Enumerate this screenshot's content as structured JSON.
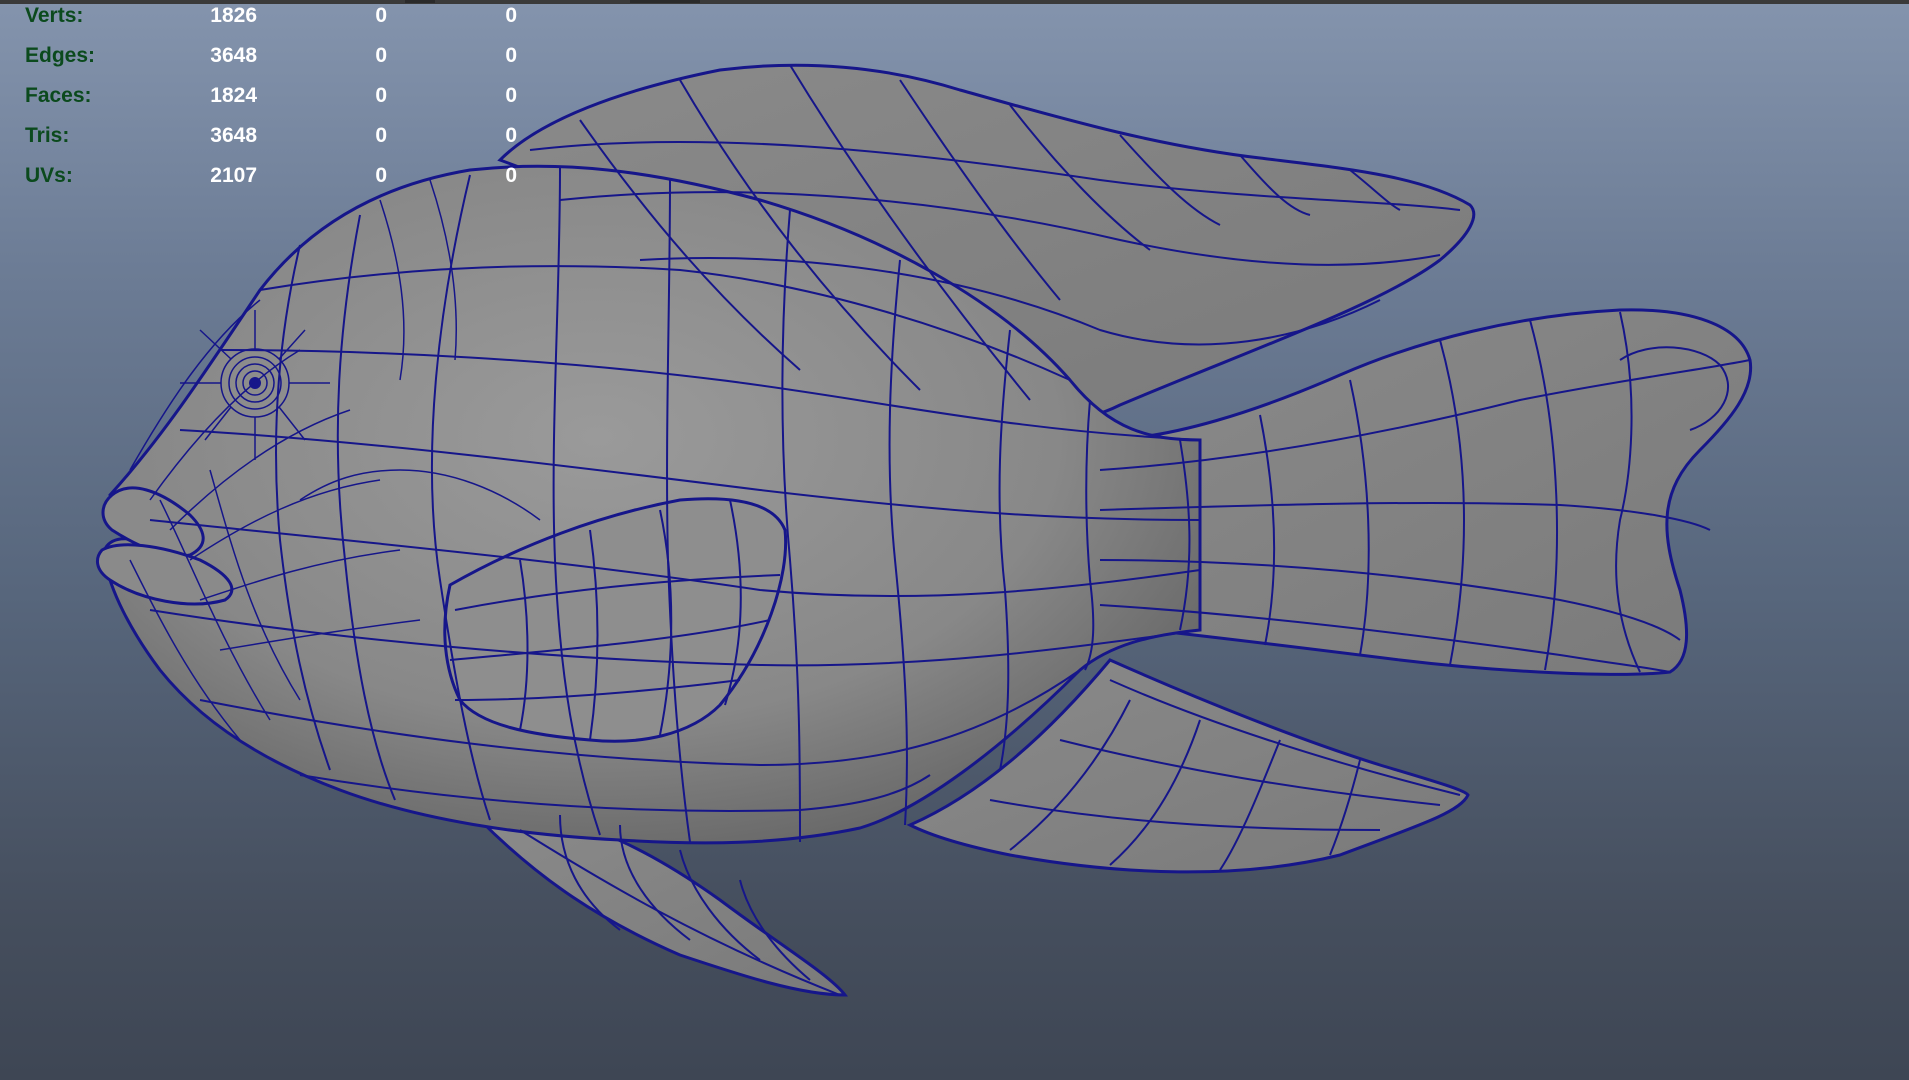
{
  "hud": {
    "rows": [
      {
        "label": "Verts:",
        "v1": "1826",
        "v2": "0",
        "v3": "0"
      },
      {
        "label": "Edges:",
        "v1": "3648",
        "v2": "0",
        "v3": "0"
      },
      {
        "label": "Faces:",
        "v1": "1824",
        "v2": "0",
        "v3": "0"
      },
      {
        "label": "Tris:",
        "v1": "3648",
        "v2": "0",
        "v3": "0"
      },
      {
        "label": "UVs:",
        "v1": "2107",
        "v2": "0",
        "v3": "0"
      }
    ]
  },
  "colors": {
    "label_green": "#0b4a1d",
    "value_white": "#ffffff",
    "wireframe_blue": "#16168a",
    "mesh_gray": "#8c8c8c",
    "background_top": "#8494ad",
    "background_bottom": "#3e4654"
  },
  "viewport": {
    "model": "fish-wireframe-mesh"
  }
}
